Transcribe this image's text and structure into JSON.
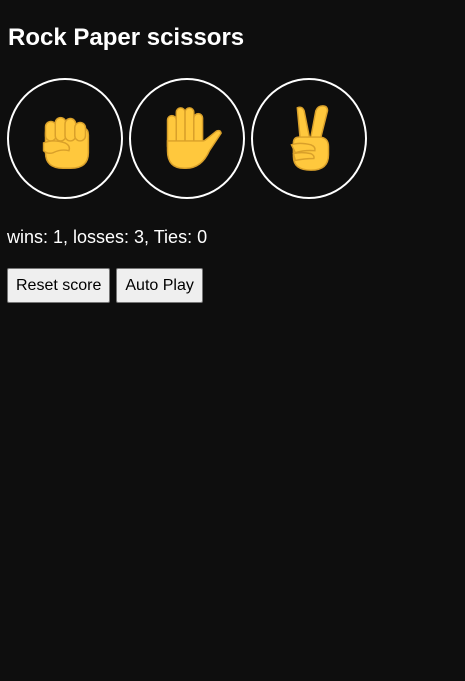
{
  "title": "Rock Paper scissors",
  "moves": [
    {
      "name": "rock",
      "icon": "raised-fist-icon"
    },
    {
      "name": "paper",
      "icon": "raised-hand-icon"
    },
    {
      "name": "scissors",
      "icon": "victory-hand-icon"
    }
  ],
  "score_text": "wins: 1, losses: 3, Ties: 0",
  "buttons": {
    "reset_label": "Reset score",
    "autoplay_label": "Auto Play"
  },
  "colors": {
    "background": "#0e0e0e",
    "text": "#ffffff",
    "emoji_skin": "#ffc83d",
    "emoji_shade": "#e0a82e",
    "button_bg": "#efefef"
  }
}
